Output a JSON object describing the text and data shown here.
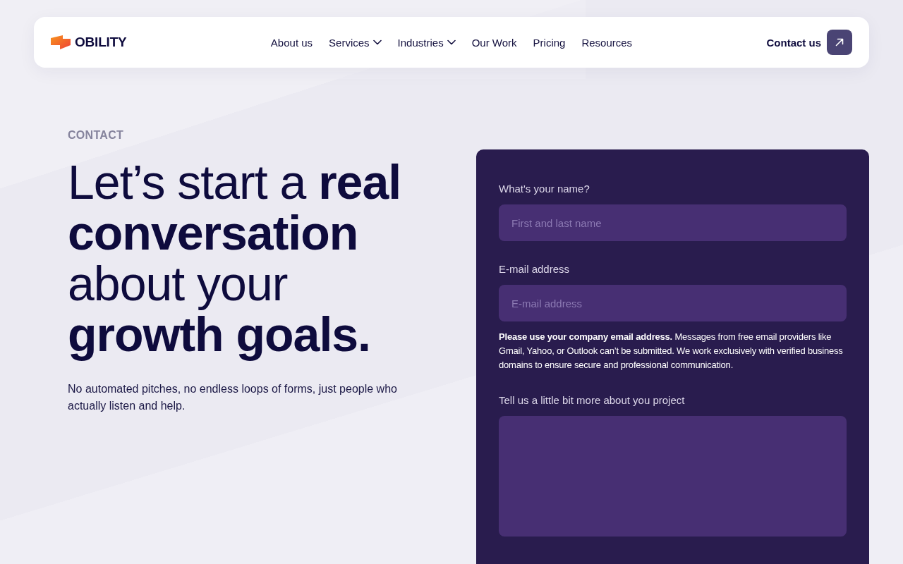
{
  "nav": {
    "logo": {
      "text": "OBILITY"
    },
    "links": [
      {
        "label": "About us",
        "dropdown": false
      },
      {
        "label": "Services",
        "dropdown": true
      },
      {
        "label": "Industries",
        "dropdown": true
      },
      {
        "label": "Our Work",
        "dropdown": false
      },
      {
        "label": "Pricing",
        "dropdown": false
      },
      {
        "label": "Resources",
        "dropdown": false
      }
    ],
    "contact": {
      "label": "Contact us"
    }
  },
  "hero": {
    "eyebrow": "CONTACT",
    "headline": "Let’s start a **real conversation** about your **growth goals.**",
    "intro": "No automated pitches, no endless loops of forms, just people who actually listen and help."
  },
  "form": {
    "fields": [
      {
        "kind": "input",
        "label": "What's your name?",
        "placeholder": "First and last name"
      },
      {
        "kind": "input",
        "label": "E-mail address",
        "placeholder": "E-mail address",
        "note": "**Please use your company email address.** Messages from free email providers like Gmail, Yahoo, or Outlook can’t be submitted. We work exclusively with verified business domains to ensure secure and professional communication."
      },
      {
        "kind": "textarea",
        "label": "Tell us a little bit more about you project"
      }
    ]
  }
}
